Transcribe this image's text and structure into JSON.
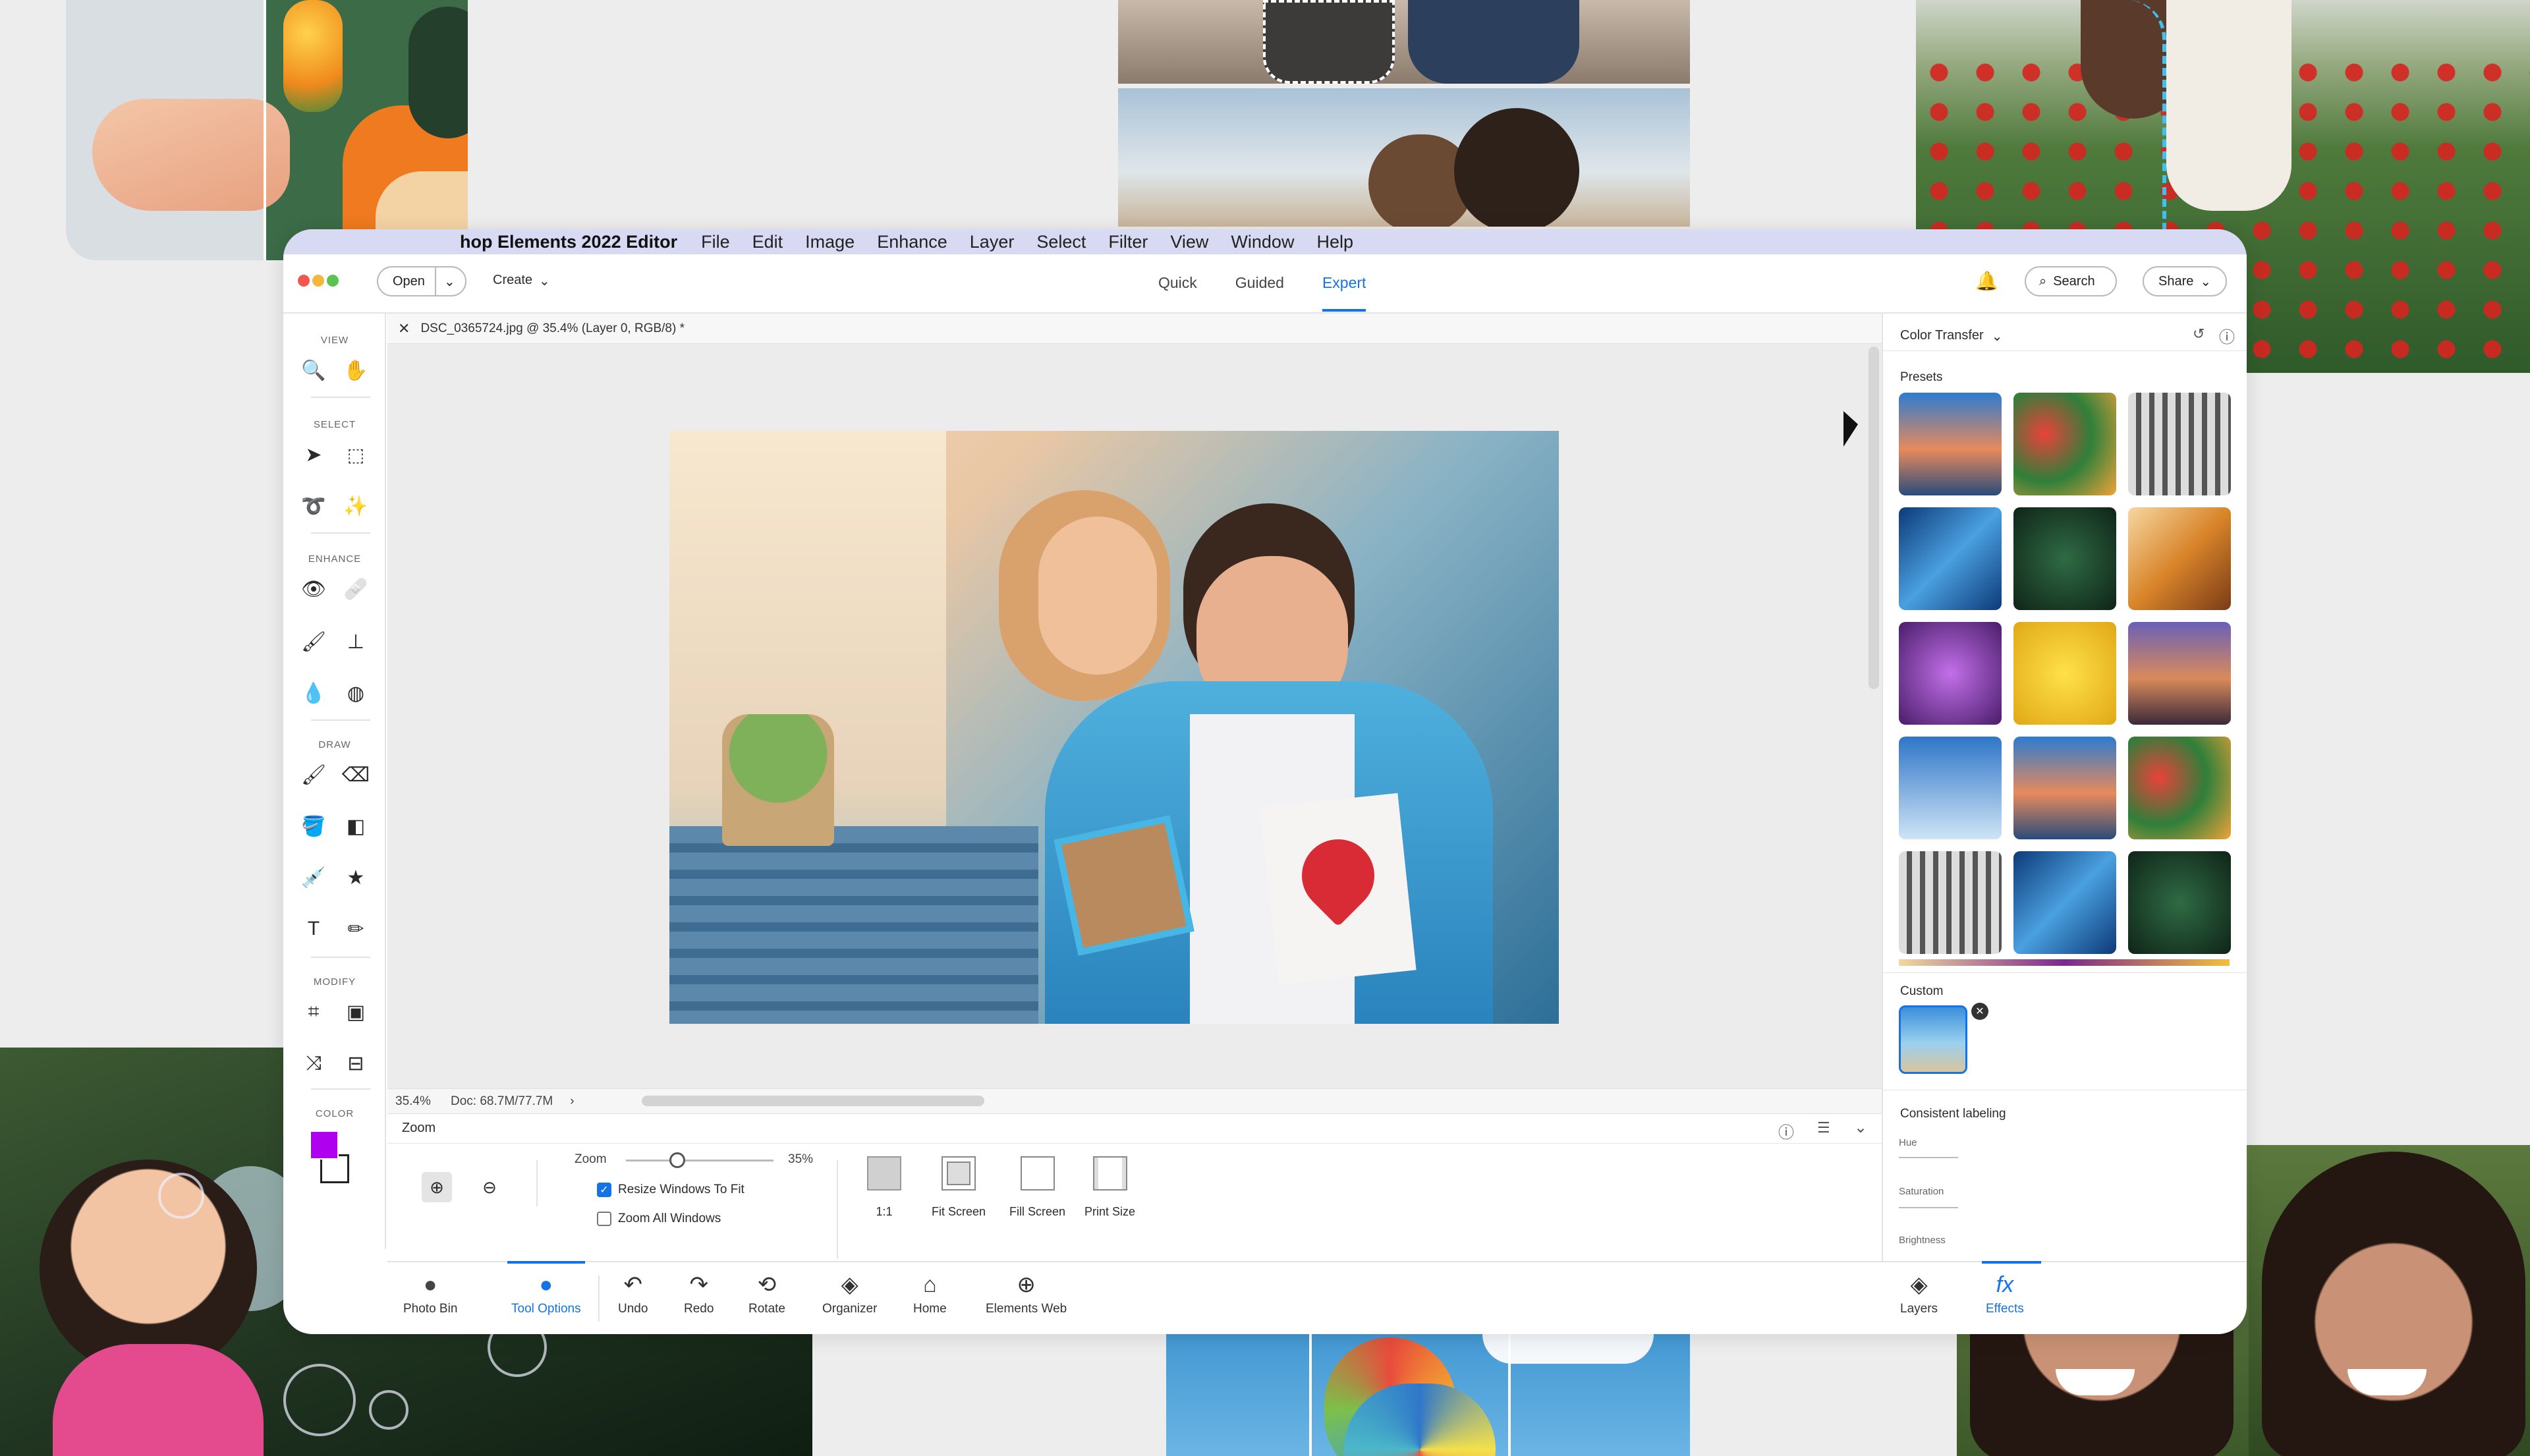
{
  "app": {
    "title": "hop Elements 2022 Editor",
    "menus": [
      "File",
      "Edit",
      "Image",
      "Enhance",
      "Layer",
      "Select",
      "Filter",
      "View",
      "Window",
      "Help"
    ]
  },
  "topbar": {
    "open_label": "Open",
    "create_label": "Create",
    "modes": [
      "Quick",
      "Guided",
      "Expert"
    ],
    "active_mode": "Expert",
    "search_label": "Search",
    "share_label": "Share"
  },
  "toolbar": {
    "sections": {
      "view": "VIEW",
      "select": "SELECT",
      "enhance": "ENHANCE",
      "draw": "DRAW",
      "modify": "MODIFY",
      "color": "COLOR"
    },
    "foreground_color": "#b000f0",
    "background_color": "#ffffff"
  },
  "document": {
    "tab_title": "DSC_0365724.jpg @ 35.4% (Layer 0, RGB/8) *",
    "zoom_status": "35.4%",
    "doc_size": "Doc: 68.7M/77.7M"
  },
  "tool_options": {
    "title": "Zoom",
    "zoom_label": "Zoom",
    "zoom_value": "35%",
    "zoom_fraction": 0.35,
    "resize_windows_label": "Resize Windows To Fit",
    "resize_windows_checked": true,
    "zoom_all_label": "Zoom All Windows",
    "zoom_all_checked": false,
    "view_buttons": [
      "1:1",
      "Fit Screen",
      "Fill Screen",
      "Print Size"
    ]
  },
  "bottombar": {
    "items": [
      "Photo Bin",
      "Tool Options",
      "Undo",
      "Redo",
      "Rotate",
      "Organizer",
      "Home",
      "Elements Web"
    ],
    "right_items": [
      "Layers",
      "Effects"
    ],
    "active": "Tool Options",
    "accent": "#1473e6"
  },
  "right_panel": {
    "title": "Color Transfer",
    "presets_label": "Presets",
    "custom_label": "Custom",
    "consistent_label": "Consistent labeling",
    "sliders": [
      "Hue",
      "Saturation",
      "Brightness"
    ]
  }
}
